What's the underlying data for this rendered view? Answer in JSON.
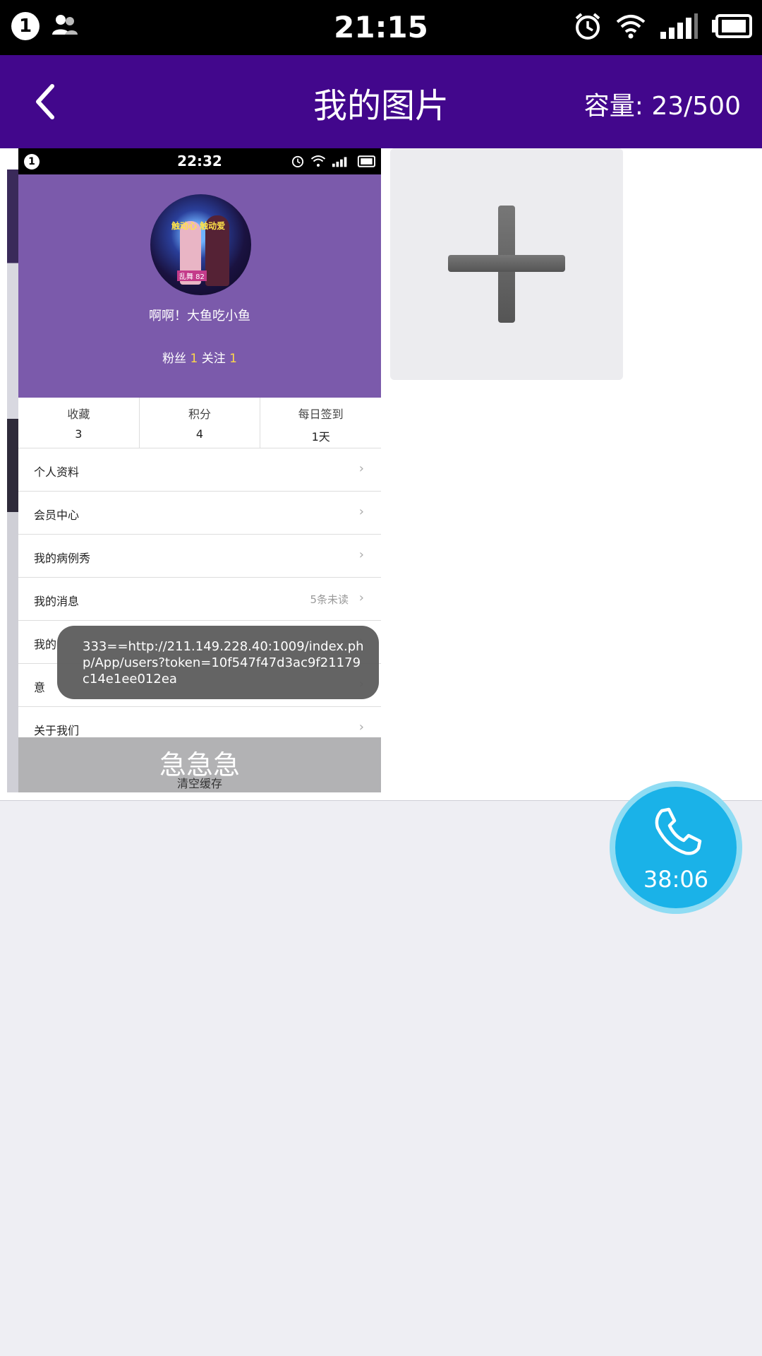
{
  "status_bar": {
    "notification_count": "1",
    "time": "21:15",
    "icons": [
      "notification-circle-icon",
      "contacts-icon",
      "alarm-icon",
      "wifi-icon",
      "signal-icon",
      "battery-icon"
    ]
  },
  "header": {
    "back_icon": "chevron-left-icon",
    "title": "我的图片",
    "capacity": "容量: 23/500"
  },
  "thumbnail": {
    "status_bar": {
      "notification_count": "1",
      "time": "22:32"
    },
    "profile": {
      "username": "啊啊！大鱼吃小鱼",
      "followers_label": "粉丝",
      "followers_count": "1",
      "following_label": "关注",
      "following_count": "1",
      "avatar_text_1": "触动心 触动爱",
      "avatar_text_2": "乱舞 82"
    },
    "stats": [
      {
        "label": "收藏",
        "value": "3"
      },
      {
        "label": "积分",
        "value": "4"
      },
      {
        "label": "每日签到",
        "value": "1天"
      }
    ],
    "menu": [
      {
        "label": "个人资料",
        "extra": ""
      },
      {
        "label": "会员中心",
        "extra": ""
      },
      {
        "label": "我的病例秀",
        "extra": ""
      },
      {
        "label": "我的消息",
        "extra": "5条未读"
      },
      {
        "label": "我的",
        "extra": ""
      },
      {
        "label": "意",
        "extra": ""
      },
      {
        "label": "关于我们",
        "extra": ""
      }
    ],
    "bottom_big": "急急急",
    "bottom_small": "清空缓存",
    "toast": "333==http://211.149.228.40:1009/index.php/App/users?token=10f547f47d3ac9f21179c14e1ee012ea"
  },
  "add_tile": {
    "icon": "plus-icon"
  },
  "call_bubble": {
    "icon": "phone-icon",
    "duration": "38:06",
    "color": "#1ab2e8"
  },
  "colors": {
    "header_bg": "#42078c",
    "profile_bg": "#7b5aab"
  }
}
